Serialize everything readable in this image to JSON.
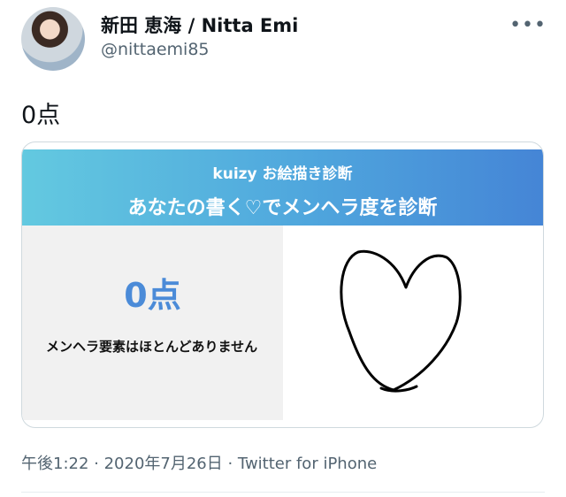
{
  "tweet": {
    "display_name": "新田 恵海 / Nitta Emi",
    "handle": "@nittaemi85",
    "more_label": "•••",
    "text": "0点",
    "timestamp": "午後1:22 · 2020年7月26日 · ",
    "client": "Twitter for iPhone"
  },
  "card": {
    "brand": "kuizy お絵描き診断",
    "title": "あなたの書く♡でメンヘラ度を診断",
    "score": "0点",
    "description": "メンヘラ要素はほとんどありません"
  },
  "icons": {
    "avatar": "user-avatar",
    "more": "more-options-icon",
    "drawing": "hand-drawn-heart"
  },
  "colors": {
    "header_gradient_start": "#63c9e0",
    "header_gradient_end": "#4585d6",
    "score": "#4b8bd8",
    "secondary_text": "#536471"
  }
}
